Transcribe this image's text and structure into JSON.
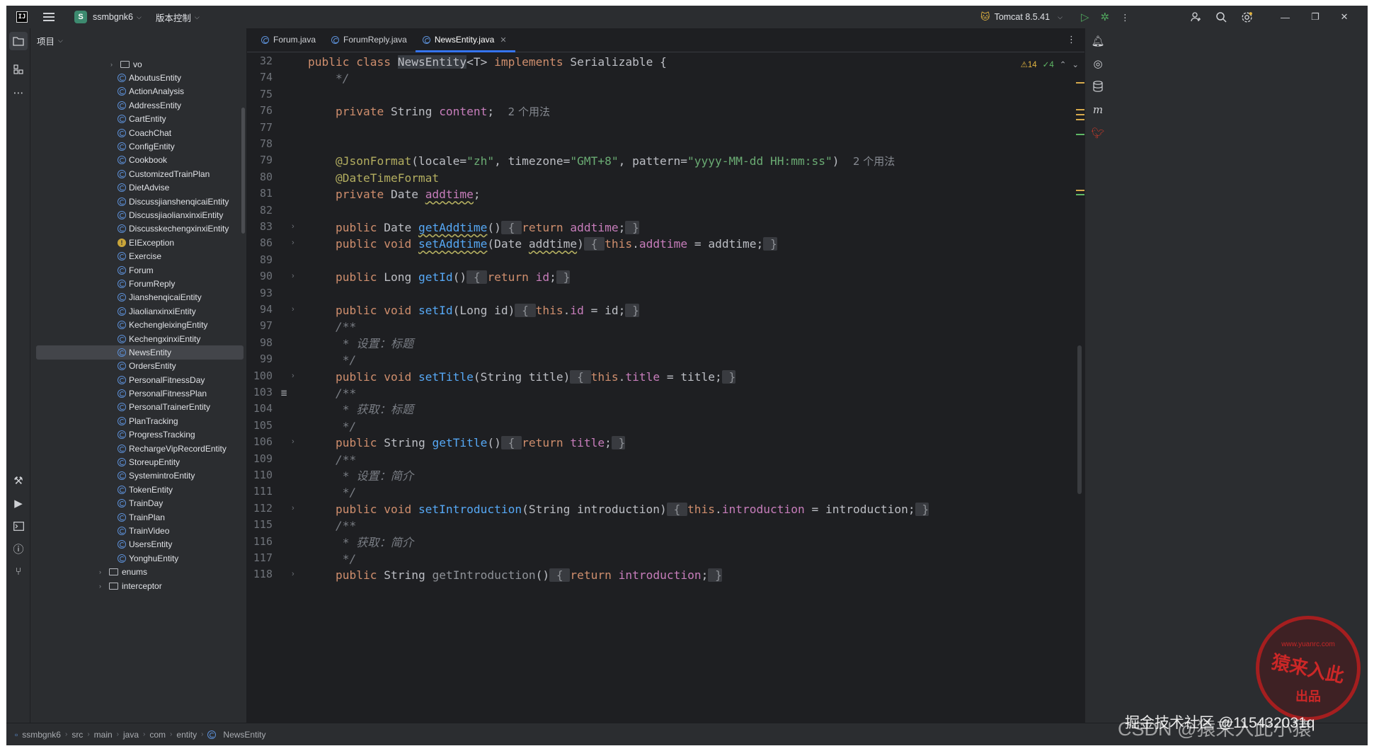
{
  "titlebar": {
    "logo": "IJ",
    "project_badge": "S",
    "project_name": "ssmbgnk6",
    "vcs_label": "版本控制",
    "run_config": "Tomcat 8.5.41"
  },
  "project_panel": {
    "header": "项目",
    "tree": [
      {
        "label": "vo",
        "kind": "folder",
        "indent": 1
      },
      {
        "label": "AboutusEntity",
        "kind": "class"
      },
      {
        "label": "ActionAnalysis",
        "kind": "class"
      },
      {
        "label": "AddressEntity",
        "kind": "class"
      },
      {
        "label": "CartEntity",
        "kind": "class"
      },
      {
        "label": "CoachChat",
        "kind": "class"
      },
      {
        "label": "ConfigEntity",
        "kind": "class"
      },
      {
        "label": "Cookbook",
        "kind": "class"
      },
      {
        "label": "CustomizedTrainPlan",
        "kind": "class"
      },
      {
        "label": "DietAdvise",
        "kind": "class"
      },
      {
        "label": "DiscussjianshenqicaiEntity",
        "kind": "class"
      },
      {
        "label": "DiscussjiaolianxinxiEntity",
        "kind": "class"
      },
      {
        "label": "DiscusskechengxinxiEntity",
        "kind": "class"
      },
      {
        "label": "EIException",
        "kind": "exception"
      },
      {
        "label": "Exercise",
        "kind": "class"
      },
      {
        "label": "Forum",
        "kind": "class"
      },
      {
        "label": "ForumReply",
        "kind": "class"
      },
      {
        "label": "JianshenqicaiEntity",
        "kind": "class"
      },
      {
        "label": "JiaolianxinxiEntity",
        "kind": "class"
      },
      {
        "label": "KechengleixingEntity",
        "kind": "class"
      },
      {
        "label": "KechengxinxiEntity",
        "kind": "class"
      },
      {
        "label": "NewsEntity",
        "kind": "class",
        "selected": true
      },
      {
        "label": "OrdersEntity",
        "kind": "class"
      },
      {
        "label": "PersonalFitnessDay",
        "kind": "class"
      },
      {
        "label": "PersonalFitnessPlan",
        "kind": "class"
      },
      {
        "label": "PersonalTrainerEntity",
        "kind": "class"
      },
      {
        "label": "PlanTracking",
        "kind": "class"
      },
      {
        "label": "ProgressTracking",
        "kind": "class"
      },
      {
        "label": "RechargeVipRecordEntity",
        "kind": "class"
      },
      {
        "label": "StoreupEntity",
        "kind": "class"
      },
      {
        "label": "SystemintroEntity",
        "kind": "class"
      },
      {
        "label": "TokenEntity",
        "kind": "class"
      },
      {
        "label": "TrainDay",
        "kind": "class"
      },
      {
        "label": "TrainPlan",
        "kind": "class"
      },
      {
        "label": "TrainVideo",
        "kind": "class"
      },
      {
        "label": "UsersEntity",
        "kind": "class"
      },
      {
        "label": "YonghuEntity",
        "kind": "class"
      },
      {
        "label": "enums",
        "kind": "folder",
        "indent": 0
      },
      {
        "label": "interceptor",
        "kind": "folder",
        "indent": 0
      }
    ]
  },
  "tabs": [
    {
      "label": "Forum.java",
      "active": false
    },
    {
      "label": "ForumReply.java",
      "active": false
    },
    {
      "label": "NewsEntity.java",
      "active": true
    }
  ],
  "inspections": {
    "warnings": "14",
    "ok": "4"
  },
  "editor": {
    "lines": [
      {
        "n": "32",
        "fold": false,
        "html": "<span class='kw'>public class </span><span class='hl-word'>NewsEntity</span>&lt;<span class='typ'>T</span>&gt; <span class='kw'>implements </span>Serializable {"
      },
      {
        "n": "74",
        "fold": false,
        "html": "    <span class='cmt'>*/</span>"
      },
      {
        "n": "75",
        "fold": false,
        "html": ""
      },
      {
        "n": "76",
        "fold": false,
        "html": "    <span class='kw'>private </span>String <span class='fld'>content</span>;  <span class='hint'>2 个用法</span>"
      },
      {
        "n": "77",
        "fold": false,
        "html": ""
      },
      {
        "n": "78",
        "fold": false,
        "html": ""
      },
      {
        "n": "79",
        "fold": false,
        "html": "    <span class='ann'>@JsonFormat</span>(locale=<span class='str'>\"zh\"</span>, timezone=<span class='str'>\"GMT+8\"</span>, pattern=<span class='str'>\"yyyy-MM-dd HH:mm:ss\"</span>)  <span class='hint'>2 个用法</span>"
      },
      {
        "n": "80",
        "fold": false,
        "html": "    <span class='ann'>@DateTimeFormat</span>"
      },
      {
        "n": "81",
        "fold": false,
        "html": "    <span class='kw'>private </span>Date <span class='fld squig'>addtime</span>;"
      },
      {
        "n": "82",
        "fold": false,
        "html": ""
      },
      {
        "n": "83",
        "fold": true,
        "html": "    <span class='kw'>public </span>Date <span class='fn squig'>getAddtime</span>()<span class='fold-box'> { </span><span class='kw'>return </span><span class='fld'>addtime</span>;<span class='fold-box'> }</span>"
      },
      {
        "n": "86",
        "fold": true,
        "html": "    <span class='kw'>public void </span><span class='fn squig'>setAddtime</span>(Date <span class='squig'>addtime</span>)<span class='fold-box'> { </span><span class='kw'>this</span>.<span class='fld'>addtime</span> = addtime;<span class='fold-box'> }</span>"
      },
      {
        "n": "89",
        "fold": false,
        "html": ""
      },
      {
        "n": "90",
        "fold": true,
        "html": "    <span class='kw'>public </span>Long <span class='fn'>getId</span>()<span class='fold-box'> { </span><span class='kw'>return </span><span class='fld'>id</span>;<span class='fold-box'> }</span>"
      },
      {
        "n": "93",
        "fold": false,
        "html": ""
      },
      {
        "n": "94",
        "fold": true,
        "html": "    <span class='kw'>public void </span><span class='fn'>setId</span>(Long id)<span class='fold-box'> { </span><span class='kw'>this</span>.<span class='fld'>id</span> = id;<span class='fold-box'> }</span>"
      },
      {
        "n": "97",
        "fold": false,
        "html": "    <span class='cmt'>/**</span>"
      },
      {
        "n": "98",
        "fold": false,
        "html": "     <span class='cmt'>* 设置：标题</span>"
      },
      {
        "n": "99",
        "fold": false,
        "html": "     <span class='cmt'>*/</span>"
      },
      {
        "n": "100",
        "fold": true,
        "html": "    <span class='kw'>public void </span><span class='fn'>setTitle</span>(String title)<span class='fold-box'> { </span><span class='kw'>this</span>.<span class='fld'>title</span> = title;<span class='fold-box'> }</span>"
      },
      {
        "n": "103",
        "fold": false,
        "doc": true,
        "html": "    <span class='cmt'>/**</span>"
      },
      {
        "n": "104",
        "fold": false,
        "html": "     <span class='cmt'>* 获取：标题</span>"
      },
      {
        "n": "105",
        "fold": false,
        "html": "     <span class='cmt'>*/</span>"
      },
      {
        "n": "106",
        "fold": true,
        "html": "    <span class='kw'>public </span>String <span class='fn'>getTitle</span>()<span class='fold-box'> { </span><span class='kw'>return </span><span class='fld'>title</span>;<span class='fold-box'> }</span>"
      },
      {
        "n": "109",
        "fold": false,
        "html": "    <span class='cmt'>/**</span>"
      },
      {
        "n": "110",
        "fold": false,
        "html": "     <span class='cmt'>* 设置：简介</span>"
      },
      {
        "n": "111",
        "fold": false,
        "html": "     <span class='cmt'>*/</span>"
      },
      {
        "n": "112",
        "fold": true,
        "html": "    <span class='kw'>public void </span><span class='fn'>setIntroduction</span>(String introduction)<span class='fold-box'> { </span><span class='kw'>this</span>.<span class='fld'>introduction</span> = introduction;<span class='fold-box'> }</span>"
      },
      {
        "n": "115",
        "fold": false,
        "html": "    <span class='cmt'>/**</span>"
      },
      {
        "n": "116",
        "fold": false,
        "html": "     <span class='cmt'>* 获取：简介</span>"
      },
      {
        "n": "117",
        "fold": false,
        "html": "     <span class='cmt'>*/</span>"
      },
      {
        "n": "118",
        "fold": true,
        "html": "    <span class='kw'>public </span>String <span class='typ' style='color:#8f9298'>getIntroduction</span>()<span class='fold-box'> { </span><span class='kw'>return </span><span class='fld'>introduction</span>;<span class='fold-box'> }</span>"
      }
    ]
  },
  "statusbar": {
    "breadcrumbs": [
      "ssmbgnk6",
      "src",
      "main",
      "java",
      "com",
      "entity",
      "NewsEntity"
    ]
  },
  "watermark": {
    "text": "掘金技术社区 @115432031q",
    "overlay": "CSDN @猿来入此小猿",
    "seal_lines": [
      "猿来入此",
      "出品",
      "www.yuanrc.com"
    ]
  },
  "colors": {
    "keyword": "#cf8e6d",
    "method": "#56a8f5",
    "field": "#c77dbb",
    "string": "#6aab73",
    "annotation": "#b3ae60",
    "comment": "#7a7e85",
    "accent": "#3574f0"
  }
}
